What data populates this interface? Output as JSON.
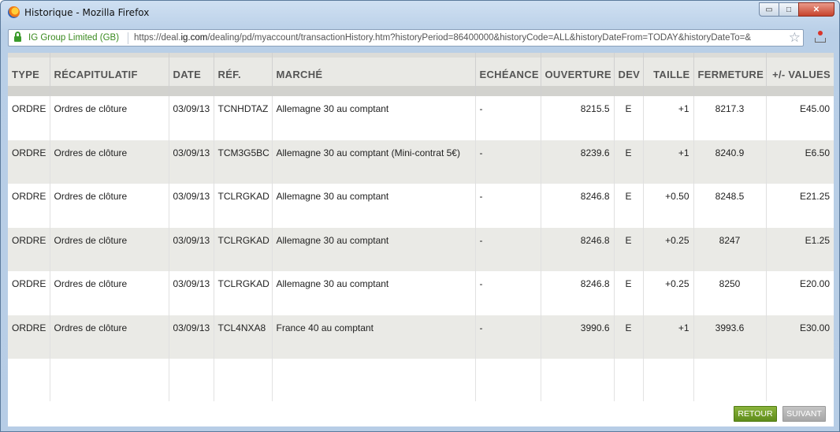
{
  "window": {
    "title": "Historique - Mozilla Firefox",
    "controls": {
      "minimize": "▭",
      "maximize": "□",
      "close": "✕"
    }
  },
  "urlbar": {
    "identity": "IG Group Limited (GB)",
    "url_prefix": "https://deal.",
    "url_domain": "ig.com",
    "url_rest": "/dealing/pd/myaccount/transactionHistory.htm?historyPeriod=86400000&historyCode=ALL&historyDateFrom=TODAY&historyDateTo=&",
    "star_icon": "☆"
  },
  "table": {
    "headers": [
      "TYPE",
      "RÉCAPITULATIF",
      "DATE",
      "RÉF.",
      "MARCHÉ",
      "ECHÉANCE",
      "OUVERTURE",
      "DEV",
      "TAILLE",
      "FERMETURE",
      "+/- VALUES"
    ],
    "rows": [
      [
        "ORDRE",
        "Ordres de clôture",
        "03/09/13",
        "TCNHDTAZ",
        "Allemagne 30 au comptant",
        "-",
        "8215.5",
        "E",
        "+1",
        "8217.3",
        "E45.00"
      ],
      [
        "ORDRE",
        "Ordres de clôture",
        "03/09/13",
        "TCM3G5BC",
        "Allemagne 30 au comptant (Mini-contrat 5€)",
        "-",
        "8239.6",
        "E",
        "+1",
        "8240.9",
        "E6.50"
      ],
      [
        "ORDRE",
        "Ordres de clôture",
        "03/09/13",
        "TCLRGKAD",
        "Allemagne 30 au comptant",
        "-",
        "8246.8",
        "E",
        "+0.50",
        "8248.5",
        "E21.25"
      ],
      [
        "ORDRE",
        "Ordres de clôture",
        "03/09/13",
        "TCLRGKAD",
        "Allemagne 30 au comptant",
        "-",
        "8246.8",
        "E",
        "+0.25",
        "8247",
        "E1.25"
      ],
      [
        "ORDRE",
        "Ordres de clôture",
        "03/09/13",
        "TCLRGKAD",
        "Allemagne 30 au comptant",
        "-",
        "8246.8",
        "E",
        "+0.25",
        "8250",
        "E20.00"
      ],
      [
        "ORDRE",
        "Ordres de clôture",
        "03/09/13",
        "TCL4NXA8",
        "France 40 au comptant",
        "-",
        "3990.6",
        "E",
        "+1",
        "3993.6",
        "E30.00"
      ]
    ]
  },
  "buttons": {
    "back": "RETOUR",
    "next": "SUIVANT"
  },
  "colors": {
    "accent_green": "#6a9a22",
    "disabled_grey": "#b0b0b0",
    "stripe": "#eaeae6"
  }
}
